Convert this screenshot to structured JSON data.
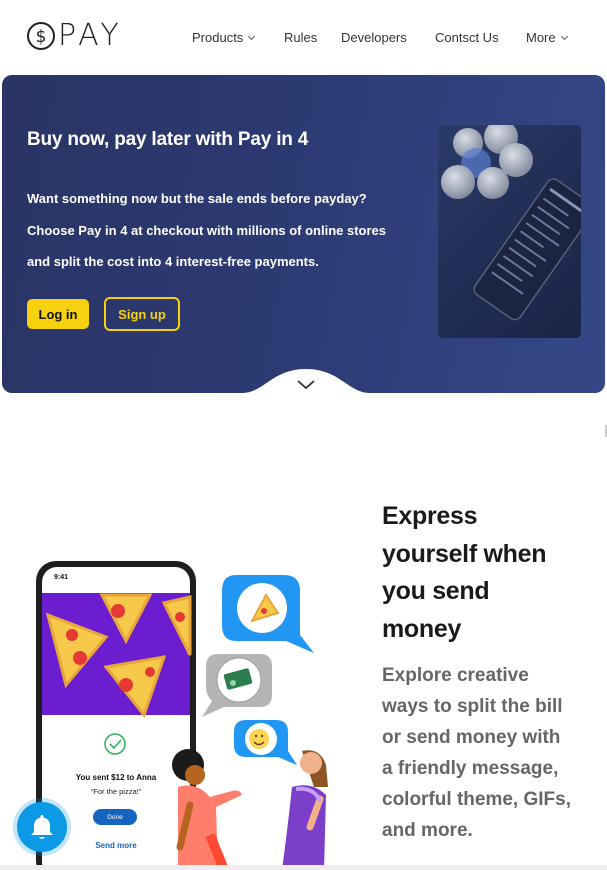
{
  "header": {
    "logo_text": "PAY",
    "nav": [
      {
        "label": "Products",
        "has_dropdown": true
      },
      {
        "label": "Rules",
        "has_dropdown": false
      },
      {
        "label": "Developers",
        "has_dropdown": false
      },
      {
        "label": "Contsct Us",
        "has_dropdown": false
      },
      {
        "label": "More",
        "has_dropdown": true
      }
    ]
  },
  "hero": {
    "title": "Buy now, pay later with Pay in 4",
    "desc_lines": [
      "Want something now but the sale ends before payday?",
      "Choose Pay in 4 at checkout with millions of online stores",
      "and split the cost into 4 interest-free payments."
    ],
    "login_label": "Log in",
    "signup_label": "Sign up"
  },
  "section2": {
    "title_lines": [
      "Express",
      "yourself when",
      "you send",
      "money"
    ],
    "desc_lines": [
      "Explore creative",
      "ways to split the bill",
      "or send money with",
      "a friendly message,",
      "colorful theme, GIFs,",
      "and more."
    ],
    "phone": {
      "time": "9:41",
      "sent_text": "You sent $12 to Anna",
      "quote": "“For the pizza!”",
      "done_label": "Done",
      "send_more_label": "Send more"
    }
  },
  "colors": {
    "hero_bg": "#2c3a72",
    "accent_yellow": "#f6d20e",
    "bell_blue": "#0c99e6",
    "pizza_purple": "#6a1ecf",
    "bubble_blue": "#2196f3"
  },
  "icons": [
    "dollar-coin-icon",
    "chevron-down-icon",
    "notification-bell-icon",
    "check-circle-icon"
  ]
}
